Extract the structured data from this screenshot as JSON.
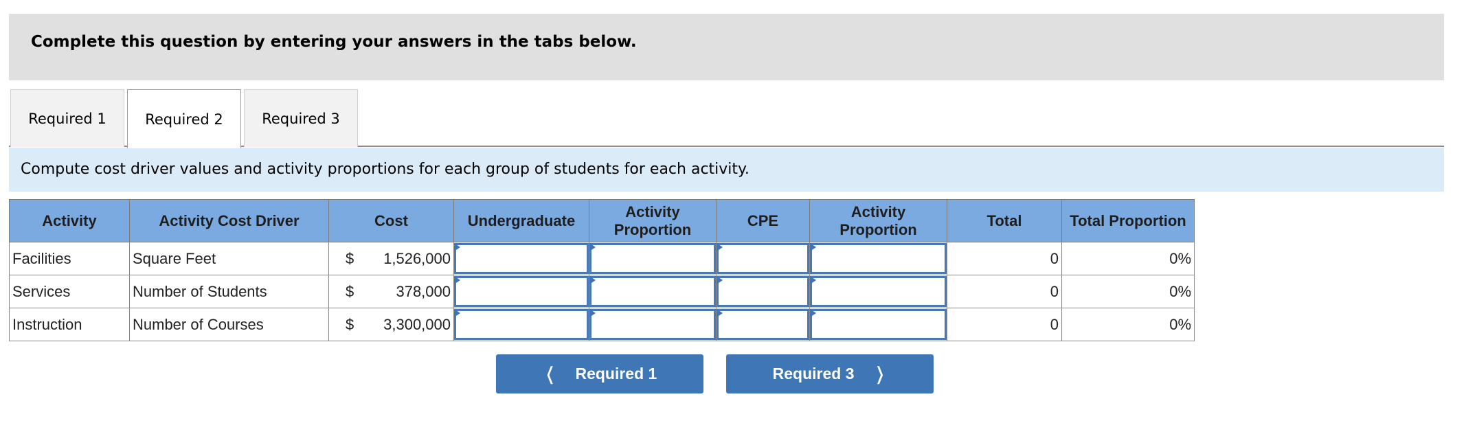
{
  "prompt": {
    "text": "Complete this question by entering your answers in the tabs below."
  },
  "tabs": [
    {
      "label": "Required 1",
      "active": false
    },
    {
      "label": "Required 2",
      "active": true
    },
    {
      "label": "Required 3",
      "active": false
    }
  ],
  "instruction": "Compute cost driver values and activity proportions for each group of students for each activity.",
  "table": {
    "headers": [
      "Activity",
      "Activity Cost Driver",
      "Cost",
      "Undergraduate",
      "Activity Proportion",
      "CPE",
      "Activity Proportion",
      "Total",
      "Total Proportion"
    ],
    "currency_symbol": "$",
    "rows": [
      {
        "activity": "Facilities",
        "driver": "Square Feet",
        "cost": "1,526,000",
        "undergraduate": "",
        "ug_proportion": "",
        "cpe": "",
        "cpe_proportion": "",
        "total": "0",
        "total_proportion": "0%"
      },
      {
        "activity": "Services",
        "driver": "Number of Students",
        "cost": "378,000",
        "undergraduate": "",
        "ug_proportion": "",
        "cpe": "",
        "cpe_proportion": "",
        "total": "0",
        "total_proportion": "0%"
      },
      {
        "activity": "Instruction",
        "driver": "Number of Courses",
        "cost": "3,300,000",
        "undergraduate": "",
        "ug_proportion": "",
        "cpe": "",
        "cpe_proportion": "",
        "total": "0",
        "total_proportion": "0%"
      }
    ]
  },
  "nav": {
    "prev_label": "Required 1",
    "prev_icon": "chevron-left-icon",
    "next_label": "Required 3",
    "next_icon": "chevron-right-icon"
  },
  "colors": {
    "header_bg": "#7aaae0",
    "button_bg": "#3e76b6",
    "instruction_bg": "#dbebf7",
    "prompt_bg": "#e0e0e0"
  }
}
